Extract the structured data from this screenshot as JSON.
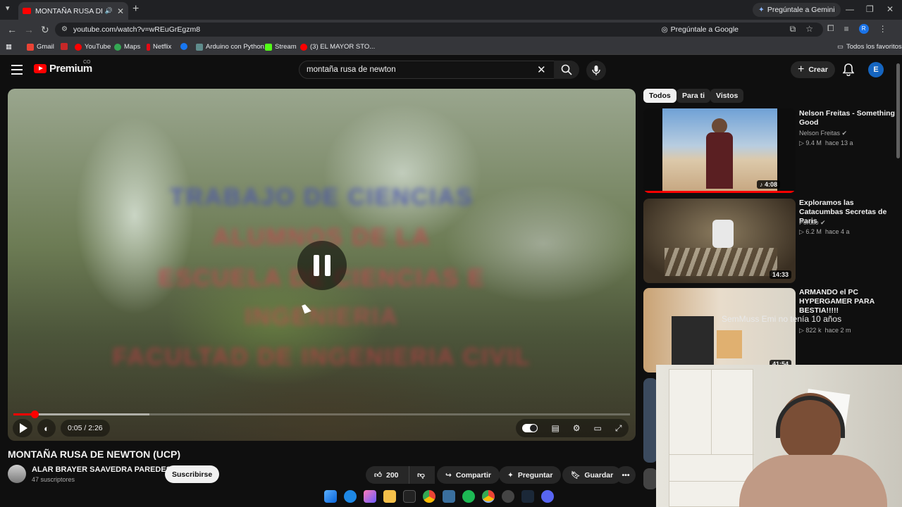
{
  "browser": {
    "tab_title": "MONTAÑA RUSA DE NEWTON (UCP) - YouTube",
    "gemini_label": "Pregúntale a Gemini",
    "url": "youtube.com/watch?v=wREuGrEgzm8",
    "ask_google_label": "Pregúntale a Google",
    "profile_initial": "R"
  },
  "bookmarks": {
    "items": [
      "Gmail",
      "YouTube",
      "Maps",
      "Netflix",
      "Arduino con Python.",
      "Stream",
      "(3) EL MAYOR STO..."
    ],
    "all_favorites": "Todos los favoritos"
  },
  "yt": {
    "logo_text": "Premium",
    "region": "CO",
    "search_value": "montaña rusa de newton",
    "create_label": "Crear",
    "user_initial": "E"
  },
  "player": {
    "overlay_lines": [
      "TRABAJO DE CIENCIAS",
      "ALUMNOS DE LA",
      "ESCUELA DE CIENCIAS E",
      "INGENIERIA",
      "FACULTAD DE INGENIERIA CIVIL"
    ],
    "time": "0:05 / 2:26",
    "progress": 0.034,
    "buffered": 0.22
  },
  "video": {
    "title": "MONTAÑA RUSA DE NEWTON (UCP)",
    "channel": "ALAR BRAYER SAAVEDRA PAREDES",
    "subscribers": "47 suscriptores",
    "subscribe_label": "Suscribirse",
    "likes": "200",
    "share_label": "Compartir",
    "ask_label": "Preguntar",
    "save_label": "Guardar"
  },
  "sidebar": {
    "chips": [
      "Todos",
      "Para ti",
      "Vistos"
    ],
    "videos": [
      {
        "title": "Nelson Freitas - Something Good",
        "channel": "Nelson Freitas",
        "views": "9.4 M",
        "age": "hace 13 a",
        "duration": "4:08"
      },
      {
        "title": "Exploramos las Catacumbas Secretas de Paris",
        "channel": "Portillo",
        "views": "6.2 M",
        "age": "hace 4 a",
        "duration": "14:33"
      },
      {
        "title": "ARMANDO el PC HYPERGAMER PARA BESTIA!!!!!",
        "channel": "",
        "views": "822 k",
        "age": "hace 2 m",
        "duration": "41:54"
      }
    ],
    "overlay_chat": "SemMuss  Emi no tenía 10 años"
  }
}
